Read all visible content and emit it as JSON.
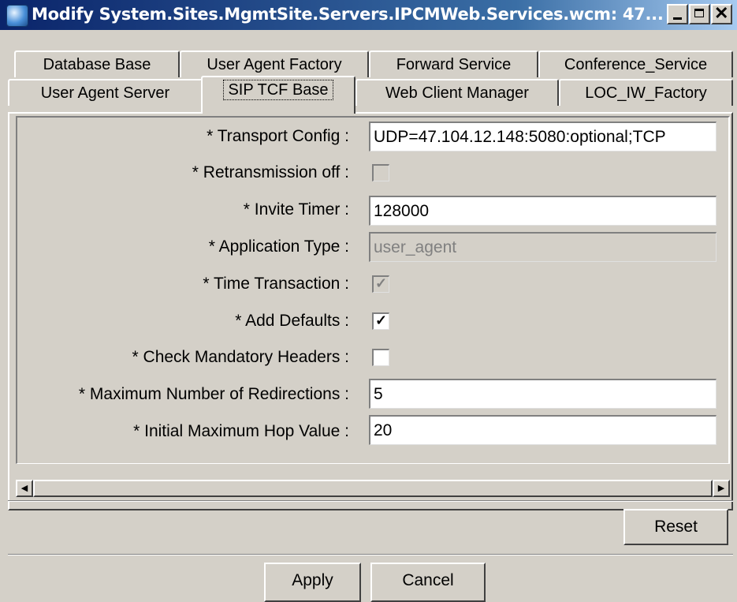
{
  "window": {
    "title": "Modify System.Sites.MgmtSite.Servers.IPCMWeb.Services.wcm: 47...",
    "controls": [
      "minimize",
      "maximize",
      "close"
    ],
    "close_glyph": "✕"
  },
  "tabs": {
    "row1": [
      "Database Base",
      "User Agent Factory",
      "Forward Service",
      "Conference_Service"
    ],
    "row2": [
      "User Agent Server",
      "SIP TCF Base",
      "Web Client Manager",
      "LOC_IW_Factory"
    ],
    "selected": "SIP TCF Base"
  },
  "form": {
    "transport_config": {
      "label": "* Transport Config :",
      "value": "UDP=47.104.12.148:5080:optional;TCP"
    },
    "retransmission_off": {
      "label": "* Retransmission off :",
      "checked": false,
      "enabled": false
    },
    "invite_timer": {
      "label": "* Invite Timer :",
      "value": "128000"
    },
    "application_type": {
      "label": "* Application Type :",
      "value": "user_agent",
      "enabled": false
    },
    "time_transaction": {
      "label": "* Time Transaction :",
      "checked": true,
      "enabled": false,
      "mark": "✓"
    },
    "add_defaults": {
      "label": "* Add Defaults :",
      "checked": true,
      "mark": "✓"
    },
    "check_mandatory_headers": {
      "label": "* Check Mandatory Headers :",
      "checked": false
    },
    "max_redirections": {
      "label": "* Maximum Number of Redirections :",
      "value": "5"
    },
    "initial_max_hop": {
      "label": "* Initial Maximum Hop Value :",
      "value": "20"
    }
  },
  "scrollbar": {
    "left_arrow": "◀",
    "right_arrow": "▶"
  },
  "buttons": {
    "reset": "Reset",
    "apply": "Apply",
    "cancel": "Cancel"
  },
  "colors": {
    "face": "#d4d0c8",
    "title_start": "#0a246a",
    "title_end": "#a6caf0"
  }
}
